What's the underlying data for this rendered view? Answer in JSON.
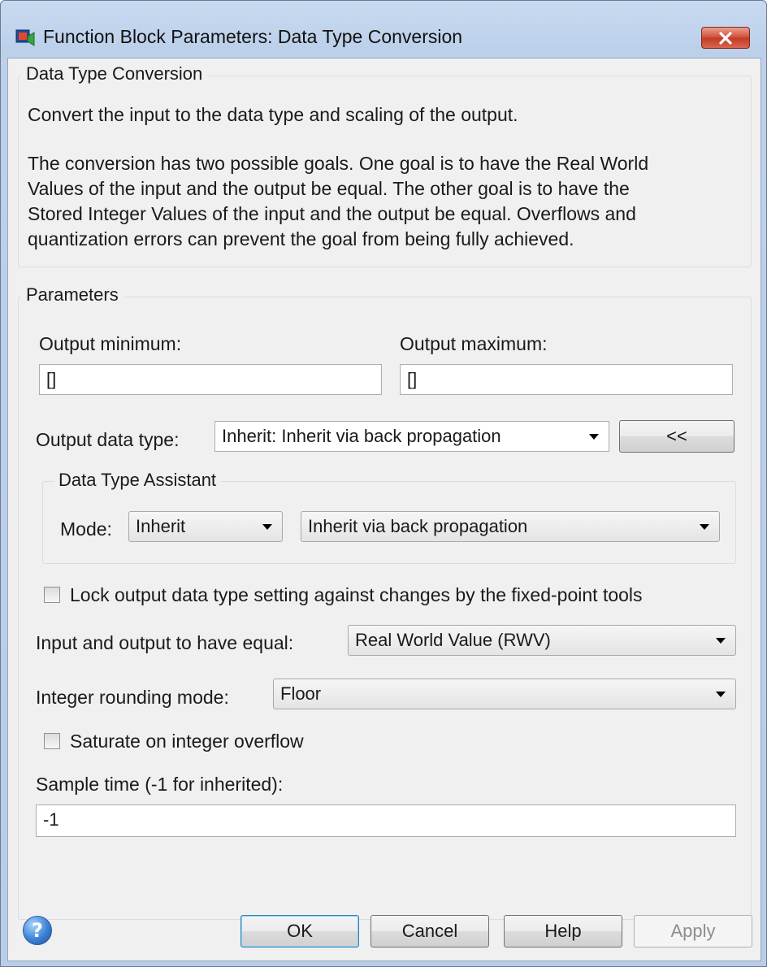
{
  "window": {
    "title": "Function Block Parameters: Data Type Conversion"
  },
  "description": {
    "group_title": "Data Type Conversion",
    "line1": "Convert the input to the data type and scaling of the output.",
    "para_lines": [
      "The conversion has two possible goals. One goal is to have the Real World",
      "Values of the input and the output be equal.  The other goal is to have the",
      "Stored Integer Values of the input and the output be equal.  Overflows and",
      "quantization errors can prevent the goal from being fully achieved."
    ]
  },
  "parameters": {
    "group_title": "Parameters",
    "output_minimum": {
      "label": "Output minimum:",
      "value": "[]"
    },
    "output_maximum": {
      "label": "Output maximum:",
      "value": "[]"
    },
    "output_data_type": {
      "label": "Output data type:",
      "value": "Inherit: Inherit via back propagation",
      "assistant_button": "<<"
    },
    "assistant": {
      "group_title": "Data Type Assistant",
      "mode_label": "Mode:",
      "mode_value": "Inherit",
      "inherit_value": "Inherit via back propagation"
    },
    "lock_checkbox": {
      "label": "Lock output data type setting against changes by the fixed-point tools",
      "checked": false
    },
    "equal": {
      "label": "Input and output to have equal:",
      "value": "Real World Value (RWV)"
    },
    "rounding": {
      "label": "Integer rounding mode:",
      "value": "Floor"
    },
    "saturate_checkbox": {
      "label": "Saturate on integer overflow",
      "checked": false
    },
    "sample_time": {
      "label": "Sample time (-1 for inherited):",
      "value": "-1"
    }
  },
  "buttons": {
    "ok": "OK",
    "cancel": "Cancel",
    "help": "Help",
    "apply": "Apply",
    "help_icon_glyph": "?"
  },
  "icons": {
    "title": "simulink-block-icon",
    "close": "close-icon",
    "help": "help-icon"
  },
  "colors": {
    "close_button": "#c23a24",
    "default_button_border": "#3c7fb1"
  }
}
